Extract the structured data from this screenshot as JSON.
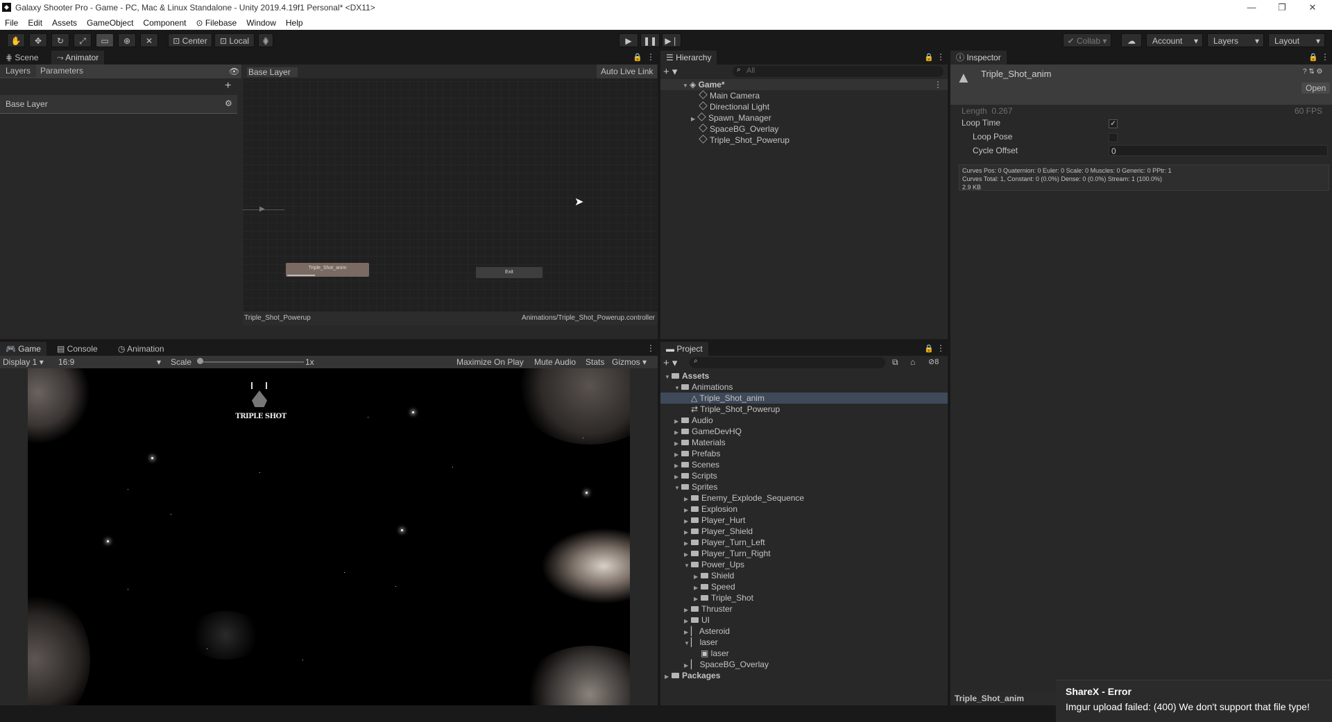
{
  "window": {
    "title": "Galaxy Shooter Pro - Game - PC, Mac & Linux Standalone - Unity 2019.4.19f1 Personal* <DX11>",
    "controls": [
      "—",
      "❐",
      "✕"
    ]
  },
  "menu": [
    "File",
    "Edit",
    "Assets",
    "GameObject",
    "Component",
    "Filebase",
    "Window",
    "Help"
  ],
  "toolbar": {
    "pivot": "Center",
    "space": "Local",
    "collab": "Collab",
    "account": "Account",
    "layers": "Layers",
    "layout": "Layout"
  },
  "animator": {
    "tabs": [
      "Scene",
      "Animator"
    ],
    "subtabs": [
      "Layers",
      "Parameters"
    ],
    "layer_name": "Base Layer",
    "breadcrumb": "Base Layer",
    "auto_live_link": "Auto Live Link",
    "nodes": {
      "state": "Triple_Shot_anim",
      "exit": "Exit"
    },
    "footer_left": "Triple_Shot_Powerup",
    "footer_right": "Animations/Triple_Shot_Powerup.controller"
  },
  "hierarchy": {
    "tab": "Hierarchy",
    "search_placeholder": "All",
    "root": "Game*",
    "items": [
      "Main Camera",
      "Directional Light",
      "Spawn_Manager",
      "SpaceBG_Overlay",
      "Triple_Shot_Powerup"
    ]
  },
  "inspector": {
    "tab": "Inspector",
    "asset_name": "Triple_Shot_anim",
    "open": "Open",
    "length_label": "Length",
    "length_value": "0.267",
    "fps": "60 FPS",
    "loop_time": "Loop Time",
    "loop_pose": "Loop Pose",
    "cycle_offset": "Cycle Offset",
    "cycle_offset_value": "0",
    "stats": [
      "Curves Pos: 0 Quaternion: 0 Euler: 0 Scale: 0 Muscles: 0 Generic: 0 PPtr: 1",
      "Curves Total: 1, Constant: 0 (0.0%) Dense: 0 (0.0%) Stream: 1 (100.0%)",
      "2.9 KB"
    ],
    "footer": "Triple_Shot_anim"
  },
  "game": {
    "tabs": [
      "Game",
      "Console",
      "Animation"
    ],
    "display": "Display 1",
    "aspect": "16:9",
    "scale_label": "Scale",
    "scale_value": "1x",
    "options": [
      "Maximize On Play",
      "Mute Audio",
      "Stats",
      "Gizmos"
    ],
    "powerup_text": "TRIPLE SHOT"
  },
  "project": {
    "tab": "Project",
    "badge": "8",
    "tree": [
      {
        "label": "Assets",
        "depth": 0,
        "type": "folder",
        "open": true,
        "bold": true
      },
      {
        "label": "Animations",
        "depth": 1,
        "type": "folder",
        "open": true
      },
      {
        "label": "Triple_Shot_anim",
        "depth": 2,
        "type": "anim",
        "selected": true
      },
      {
        "label": "Triple_Shot_Powerup",
        "depth": 2,
        "type": "controller"
      },
      {
        "label": "Audio",
        "depth": 1,
        "type": "folder"
      },
      {
        "label": "GameDevHQ",
        "depth": 1,
        "type": "folder"
      },
      {
        "label": "Materials",
        "depth": 1,
        "type": "folder"
      },
      {
        "label": "Prefabs",
        "depth": 1,
        "type": "folder"
      },
      {
        "label": "Scenes",
        "depth": 1,
        "type": "folder"
      },
      {
        "label": "Scripts",
        "depth": 1,
        "type": "folder"
      },
      {
        "label": "Sprites",
        "depth": 1,
        "type": "folder",
        "open": true
      },
      {
        "label": "Enemy_Explode_Sequence",
        "depth": 2,
        "type": "folder"
      },
      {
        "label": "Explosion",
        "depth": 2,
        "type": "folder"
      },
      {
        "label": "Player_Hurt",
        "depth": 2,
        "type": "folder"
      },
      {
        "label": "Player_Shield",
        "depth": 2,
        "type": "folder"
      },
      {
        "label": "Player_Turn_Left",
        "depth": 2,
        "type": "folder"
      },
      {
        "label": "Player_Turn_Right",
        "depth": 2,
        "type": "folder"
      },
      {
        "label": "Power_Ups",
        "depth": 2,
        "type": "folder",
        "open": true
      },
      {
        "label": "Shield",
        "depth": 3,
        "type": "folder"
      },
      {
        "label": "Speed",
        "depth": 3,
        "type": "folder"
      },
      {
        "label": "Triple_Shot",
        "depth": 3,
        "type": "folder"
      },
      {
        "label": "Thruster",
        "depth": 2,
        "type": "folder"
      },
      {
        "label": "UI",
        "depth": 2,
        "type": "folder"
      },
      {
        "label": "Asteroid",
        "depth": 2,
        "type": "sprite"
      },
      {
        "label": "laser",
        "depth": 2,
        "type": "sprite",
        "open": true
      },
      {
        "label": "laser",
        "depth": 3,
        "type": "subsprite"
      },
      {
        "label": "SpaceBG_Overlay",
        "depth": 2,
        "type": "sprite"
      },
      {
        "label": "Packages",
        "depth": 0,
        "type": "folder",
        "bold": true
      }
    ]
  },
  "toast": {
    "title": "ShareX - Error",
    "message": "Imgur upload failed: (400) We don't support that file type!"
  }
}
